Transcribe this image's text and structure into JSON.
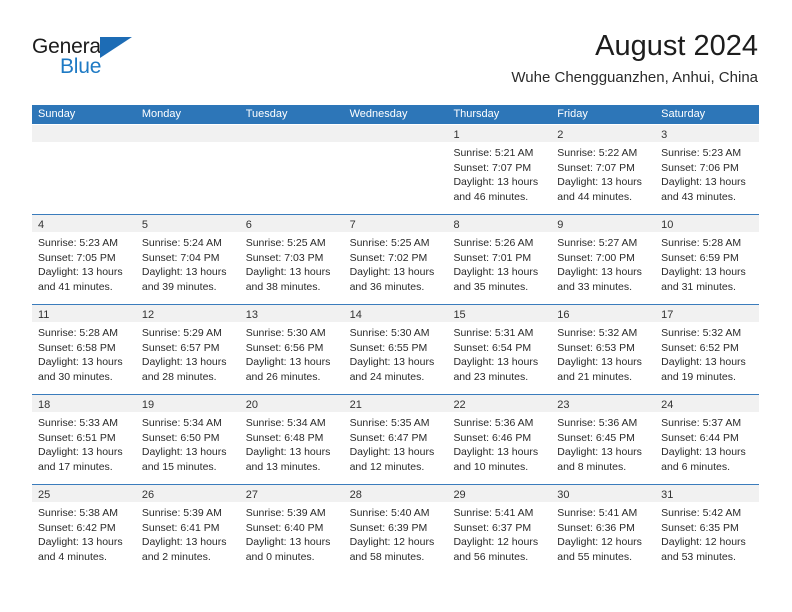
{
  "brand": {
    "name_top": "General",
    "name_bottom": "Blue",
    "accent_color": "#1d6cb5",
    "blue_text_color": "#1e7ac4"
  },
  "header": {
    "title": "August 2024",
    "subtitle": "Wuhe Chengguanzhen, Anhui, China"
  },
  "calendar": {
    "header_bg": "#2d76b8",
    "day_band_bg": "#f1f1f1",
    "week_separator_color": "#3b7cbc",
    "day_names": [
      "Sunday",
      "Monday",
      "Tuesday",
      "Wednesday",
      "Thursday",
      "Friday",
      "Saturday"
    ],
    "weeks": [
      [
        {
          "day": "",
          "lines": []
        },
        {
          "day": "",
          "lines": []
        },
        {
          "day": "",
          "lines": []
        },
        {
          "day": "",
          "lines": []
        },
        {
          "day": "1",
          "lines": [
            "Sunrise: 5:21 AM",
            "Sunset: 7:07 PM",
            "Daylight: 13 hours",
            "and 46 minutes."
          ]
        },
        {
          "day": "2",
          "lines": [
            "Sunrise: 5:22 AM",
            "Sunset: 7:07 PM",
            "Daylight: 13 hours",
            "and 44 minutes."
          ]
        },
        {
          "day": "3",
          "lines": [
            "Sunrise: 5:23 AM",
            "Sunset: 7:06 PM",
            "Daylight: 13 hours",
            "and 43 minutes."
          ]
        }
      ],
      [
        {
          "day": "4",
          "lines": [
            "Sunrise: 5:23 AM",
            "Sunset: 7:05 PM",
            "Daylight: 13 hours",
            "and 41 minutes."
          ]
        },
        {
          "day": "5",
          "lines": [
            "Sunrise: 5:24 AM",
            "Sunset: 7:04 PM",
            "Daylight: 13 hours",
            "and 39 minutes."
          ]
        },
        {
          "day": "6",
          "lines": [
            "Sunrise: 5:25 AM",
            "Sunset: 7:03 PM",
            "Daylight: 13 hours",
            "and 38 minutes."
          ]
        },
        {
          "day": "7",
          "lines": [
            "Sunrise: 5:25 AM",
            "Sunset: 7:02 PM",
            "Daylight: 13 hours",
            "and 36 minutes."
          ]
        },
        {
          "day": "8",
          "lines": [
            "Sunrise: 5:26 AM",
            "Sunset: 7:01 PM",
            "Daylight: 13 hours",
            "and 35 minutes."
          ]
        },
        {
          "day": "9",
          "lines": [
            "Sunrise: 5:27 AM",
            "Sunset: 7:00 PM",
            "Daylight: 13 hours",
            "and 33 minutes."
          ]
        },
        {
          "day": "10",
          "lines": [
            "Sunrise: 5:28 AM",
            "Sunset: 6:59 PM",
            "Daylight: 13 hours",
            "and 31 minutes."
          ]
        }
      ],
      [
        {
          "day": "11",
          "lines": [
            "Sunrise: 5:28 AM",
            "Sunset: 6:58 PM",
            "Daylight: 13 hours",
            "and 30 minutes."
          ]
        },
        {
          "day": "12",
          "lines": [
            "Sunrise: 5:29 AM",
            "Sunset: 6:57 PM",
            "Daylight: 13 hours",
            "and 28 minutes."
          ]
        },
        {
          "day": "13",
          "lines": [
            "Sunrise: 5:30 AM",
            "Sunset: 6:56 PM",
            "Daylight: 13 hours",
            "and 26 minutes."
          ]
        },
        {
          "day": "14",
          "lines": [
            "Sunrise: 5:30 AM",
            "Sunset: 6:55 PM",
            "Daylight: 13 hours",
            "and 24 minutes."
          ]
        },
        {
          "day": "15",
          "lines": [
            "Sunrise: 5:31 AM",
            "Sunset: 6:54 PM",
            "Daylight: 13 hours",
            "and 23 minutes."
          ]
        },
        {
          "day": "16",
          "lines": [
            "Sunrise: 5:32 AM",
            "Sunset: 6:53 PM",
            "Daylight: 13 hours",
            "and 21 minutes."
          ]
        },
        {
          "day": "17",
          "lines": [
            "Sunrise: 5:32 AM",
            "Sunset: 6:52 PM",
            "Daylight: 13 hours",
            "and 19 minutes."
          ]
        }
      ],
      [
        {
          "day": "18",
          "lines": [
            "Sunrise: 5:33 AM",
            "Sunset: 6:51 PM",
            "Daylight: 13 hours",
            "and 17 minutes."
          ]
        },
        {
          "day": "19",
          "lines": [
            "Sunrise: 5:34 AM",
            "Sunset: 6:50 PM",
            "Daylight: 13 hours",
            "and 15 minutes."
          ]
        },
        {
          "day": "20",
          "lines": [
            "Sunrise: 5:34 AM",
            "Sunset: 6:48 PM",
            "Daylight: 13 hours",
            "and 13 minutes."
          ]
        },
        {
          "day": "21",
          "lines": [
            "Sunrise: 5:35 AM",
            "Sunset: 6:47 PM",
            "Daylight: 13 hours",
            "and 12 minutes."
          ]
        },
        {
          "day": "22",
          "lines": [
            "Sunrise: 5:36 AM",
            "Sunset: 6:46 PM",
            "Daylight: 13 hours",
            "and 10 minutes."
          ]
        },
        {
          "day": "23",
          "lines": [
            "Sunrise: 5:36 AM",
            "Sunset: 6:45 PM",
            "Daylight: 13 hours",
            "and 8 minutes."
          ]
        },
        {
          "day": "24",
          "lines": [
            "Sunrise: 5:37 AM",
            "Sunset: 6:44 PM",
            "Daylight: 13 hours",
            "and 6 minutes."
          ]
        }
      ],
      [
        {
          "day": "25",
          "lines": [
            "Sunrise: 5:38 AM",
            "Sunset: 6:42 PM",
            "Daylight: 13 hours",
            "and 4 minutes."
          ]
        },
        {
          "day": "26",
          "lines": [
            "Sunrise: 5:39 AM",
            "Sunset: 6:41 PM",
            "Daylight: 13 hours",
            "and 2 minutes."
          ]
        },
        {
          "day": "27",
          "lines": [
            "Sunrise: 5:39 AM",
            "Sunset: 6:40 PM",
            "Daylight: 13 hours",
            "and 0 minutes."
          ]
        },
        {
          "day": "28",
          "lines": [
            "Sunrise: 5:40 AM",
            "Sunset: 6:39 PM",
            "Daylight: 12 hours",
            "and 58 minutes."
          ]
        },
        {
          "day": "29",
          "lines": [
            "Sunrise: 5:41 AM",
            "Sunset: 6:37 PM",
            "Daylight: 12 hours",
            "and 56 minutes."
          ]
        },
        {
          "day": "30",
          "lines": [
            "Sunrise: 5:41 AM",
            "Sunset: 6:36 PM",
            "Daylight: 12 hours",
            "and 55 minutes."
          ]
        },
        {
          "day": "31",
          "lines": [
            "Sunrise: 5:42 AM",
            "Sunset: 6:35 PM",
            "Daylight: 12 hours",
            "and 53 minutes."
          ]
        }
      ]
    ]
  }
}
